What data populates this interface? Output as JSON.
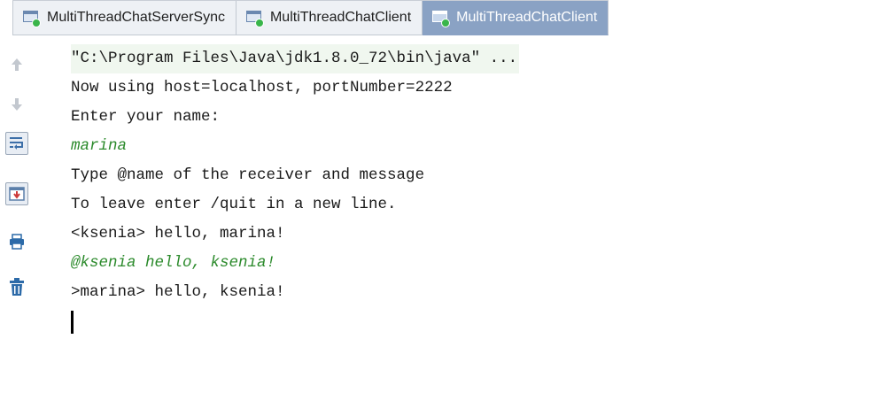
{
  "tabs": [
    {
      "label": "MultiThreadChatServerSync",
      "active": false
    },
    {
      "label": "MultiThreadChatClient",
      "active": false
    },
    {
      "label": "MultiThreadChatClient",
      "active": true
    }
  ],
  "toolbar": {
    "icons": [
      "arrow-up-icon",
      "arrow-down-icon",
      "soft-wrap-icon",
      "scroll-to-end-icon",
      "print-icon",
      "clear-all-icon"
    ]
  },
  "console": {
    "lines": [
      {
        "text": "\"C:\\Program Files\\Java\\jdk1.8.0_72\\bin\\java\" ...",
        "kind": "command"
      },
      {
        "text": "Now using host=localhost, portNumber=2222",
        "kind": "output"
      },
      {
        "text": "Enter your name:",
        "kind": "output"
      },
      {
        "text": "marina",
        "kind": "input"
      },
      {
        "text": "Type @name of the receiver and message",
        "kind": "output"
      },
      {
        "text": "To leave enter /quit in a new line.",
        "kind": "output"
      },
      {
        "text": "<ksenia> hello, marina!",
        "kind": "output"
      },
      {
        "text": "@ksenia hello, ksenia!",
        "kind": "input"
      },
      {
        "text": ">marina> hello, ksenia!",
        "kind": "output"
      }
    ]
  },
  "colors": {
    "active_tab": "#8aa2c4",
    "user_input": "#2b8a2b",
    "command_line_bg": "#f0f7ef"
  }
}
